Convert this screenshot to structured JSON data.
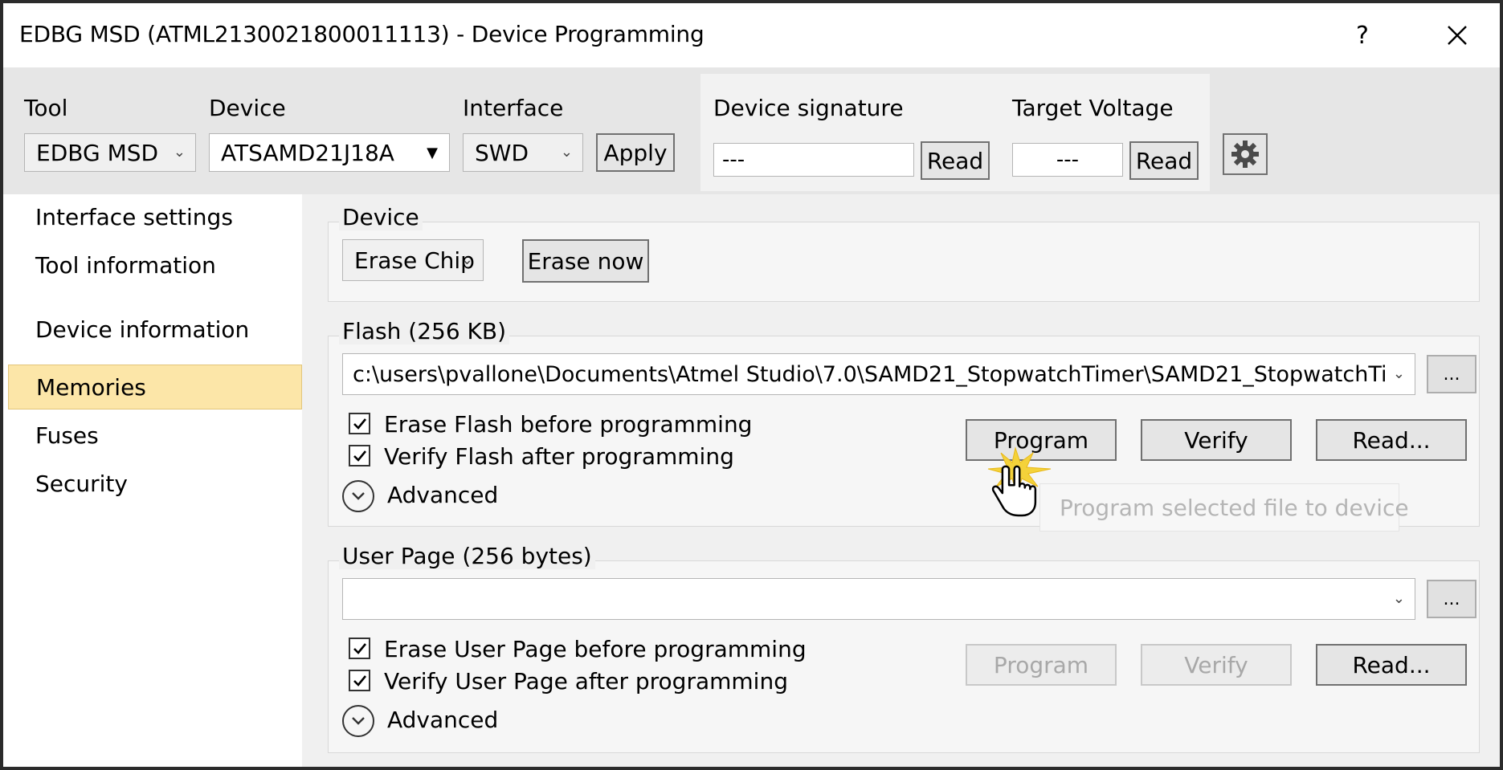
{
  "window": {
    "title": "EDBG MSD (ATML2130021800011113) - Device Programming",
    "help_label": "?",
    "close_label": "✕"
  },
  "toolbar": {
    "tool_label": "Tool",
    "tool_value": "EDBG MSD",
    "device_label": "Device",
    "device_value": "ATSAMD21J18A",
    "interface_label": "Interface",
    "interface_value": "SWD",
    "apply_label": "Apply",
    "signature_label": "Device signature",
    "signature_value": "---",
    "signature_read_label": "Read",
    "voltage_label": "Target Voltage",
    "voltage_value": "---",
    "voltage_read_label": "Read",
    "settings_icon": "gear-icon"
  },
  "sidebar": {
    "items": [
      {
        "label": "Interface settings"
      },
      {
        "label": "Tool information"
      },
      {
        "label": "Device information"
      },
      {
        "label": "Memories",
        "selected": true
      },
      {
        "label": "Fuses"
      },
      {
        "label": "Security"
      }
    ]
  },
  "device_group": {
    "label": "Device",
    "erase_mode": "Erase Chip",
    "erase_now_label": "Erase now"
  },
  "flash_group": {
    "label": "Flash (256 KB)",
    "file_path": "c:\\users\\pvallone\\Documents\\Atmel Studio\\7.0\\SAMD21_StopwatchTimer\\SAMD21_StopwatchTi",
    "browse_label": "...",
    "erase_before_label": "Erase Flash before programming",
    "erase_before_checked": true,
    "verify_after_label": "Verify Flash after programming",
    "verify_after_checked": true,
    "advanced_label": "Advanced",
    "program_label": "Program",
    "verify_label": "Verify",
    "read_label": "Read...",
    "tooltip": "Program selected file to device"
  },
  "userpage_group": {
    "label": "User Page (256 bytes)",
    "file_path": "",
    "browse_label": "...",
    "erase_before_label": "Erase User Page before programming",
    "erase_before_checked": true,
    "verify_after_label": "Verify User Page after programming",
    "verify_after_checked": true,
    "advanced_label": "Advanced",
    "program_label": "Program",
    "verify_label": "Verify",
    "read_label": "Read..."
  },
  "colors": {
    "selected_nav": "#fce6a8",
    "toolbar_bg": "#e6e6e6",
    "window_bg": "#f0f0f0"
  }
}
